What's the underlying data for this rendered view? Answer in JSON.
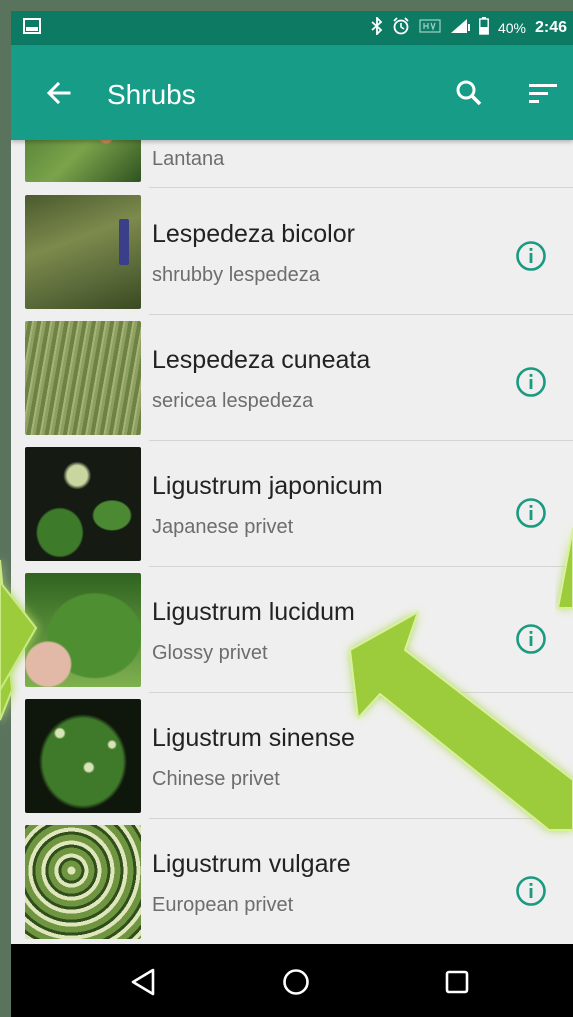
{
  "status_bar": {
    "battery": "40%",
    "time": "2:46",
    "icons": [
      "image-icon",
      "bluetooth-icon",
      "alarm-icon",
      "volte-icon",
      "signal-icon",
      "battery-icon"
    ]
  },
  "app_bar": {
    "title": "Shrubs",
    "back_icon": "arrow-left-icon",
    "search_icon": "search-icon",
    "sort_icon": "sort-icon"
  },
  "list": {
    "items": [
      {
        "scientific": "",
        "common": "Lantana",
        "info": false
      },
      {
        "scientific": "Lespedeza bicolor",
        "common": "shrubby lespedeza",
        "info": true
      },
      {
        "scientific": "Lespedeza cuneata",
        "common": "sericea lespedeza",
        "info": true
      },
      {
        "scientific": "Ligustrum japonicum",
        "common": "Japanese privet",
        "info": true
      },
      {
        "scientific": "Ligustrum lucidum",
        "common": "Glossy privet",
        "info": true
      },
      {
        "scientific": "Ligustrum sinense",
        "common": "Chinese privet",
        "info": false
      },
      {
        "scientific": "Ligustrum vulgare",
        "common": "European privet",
        "info": true
      }
    ]
  },
  "nav_bar": {
    "icons": [
      "back-triangle-icon",
      "home-circle-icon",
      "recents-square-icon"
    ]
  },
  "colors": {
    "status_bar": "#0d7b64",
    "app_bar": "#169c87",
    "info_icon": "#1a9a80",
    "highlight_arrow": "#9ccb3b"
  }
}
